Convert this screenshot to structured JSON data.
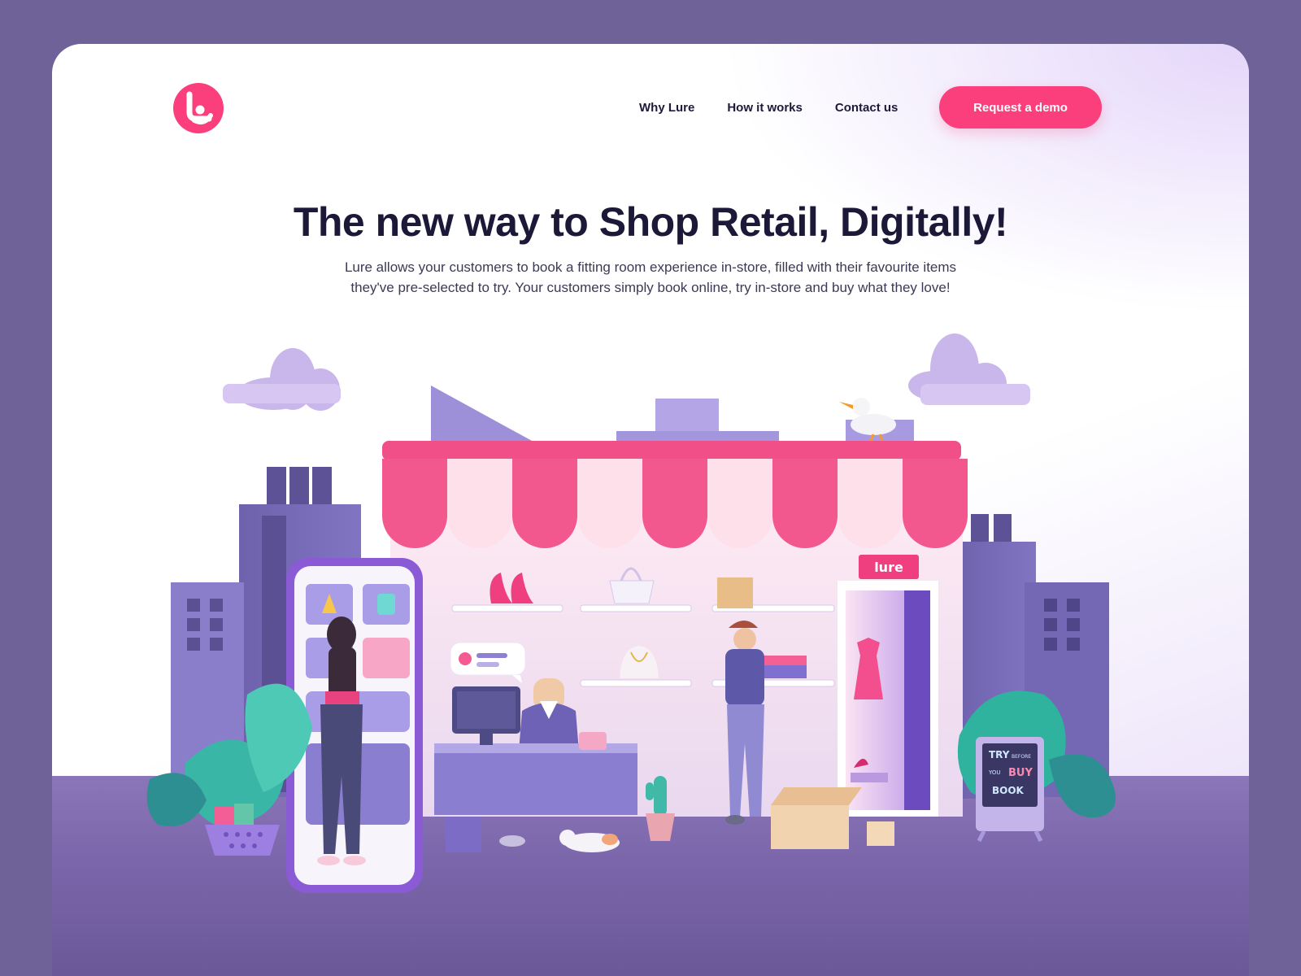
{
  "brand": {
    "name": "Lure",
    "accent": "#fb3f7c",
    "background": "#6f6299"
  },
  "nav": {
    "items": [
      {
        "label": "Why Lure"
      },
      {
        "label": "How it works"
      },
      {
        "label": "Contact us"
      }
    ],
    "cta_label": "Request a demo"
  },
  "hero": {
    "title": "The new way to Shop Retail, Digitally!",
    "subtitle": "Lure allows your customers to book a fitting room experience in-store, filled with their favourite items they've pre-selected to try. Your customers simply book online, try in-store and buy what they love!"
  },
  "illustration": {
    "store_sign": "lure",
    "board_lines": [
      "TRY",
      "BEFORE",
      "YOU",
      "BUY",
      "BOOK"
    ],
    "icons": [
      "cloud-icon",
      "store-awning-icon",
      "seagull-icon",
      "smartphone-icon",
      "cash-register-icon",
      "chat-bubble-icon",
      "fitting-room-icon",
      "cactus-icon",
      "cat-icon",
      "shopping-basket-icon",
      "cardboard-box-icon"
    ]
  }
}
